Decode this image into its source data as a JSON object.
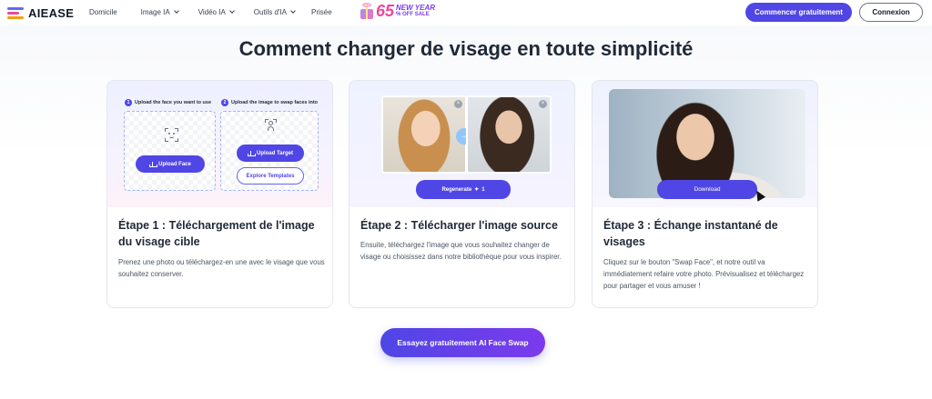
{
  "nav": {
    "logo": "AIEASE",
    "items": [
      {
        "label": "Domicile"
      },
      {
        "label": "Image IA"
      },
      {
        "label": "Vidéo IA"
      },
      {
        "label": "Outils d'IA"
      },
      {
        "label": "Prisée"
      }
    ],
    "promo": {
      "number": "65",
      "line1": "NEW YEAR",
      "line2": "% OFF SALE"
    },
    "cta_start": "Commencer gratuitement",
    "login": "Connexion"
  },
  "section": {
    "title": "Comment changer de visage en toute simplicité"
  },
  "cards": [
    {
      "step1_label": "Upload the face you want to use",
      "step2_label": "Upload the image to swap faces into",
      "step1_num": "1",
      "step2_num": "2",
      "upload_face": "Upload Face",
      "upload_target": "Upload Target",
      "explore": "Explore Templates",
      "title": "Étape 1 : Téléchargement de l'image du visage cible",
      "desc": "Prenez une photo ou téléchargez-en une avec le visage que vous souhaitez conserver."
    },
    {
      "regenerate": "Regenerate",
      "regen_count": "1",
      "title": "Étape 2 : Télécharger l'image source",
      "desc": "Ensuite, téléchargez l'image que vous souhaitez changer de visage ou choisissez dans notre bibliothèque pour vous inspirer."
    },
    {
      "download": "Download",
      "title": "Étape 3 : Échange instantané de visages",
      "desc": "Cliquez sur le bouton \"Swap Face\", et notre outil va immédiatement refaire votre photo. Prévisualisez et téléchargez pour partager et vous amuser !"
    }
  ],
  "cta": "Essayez gratuitement AI Face Swap",
  "colors": {
    "accent": "#4f46e5",
    "pink": "#ec4899"
  }
}
